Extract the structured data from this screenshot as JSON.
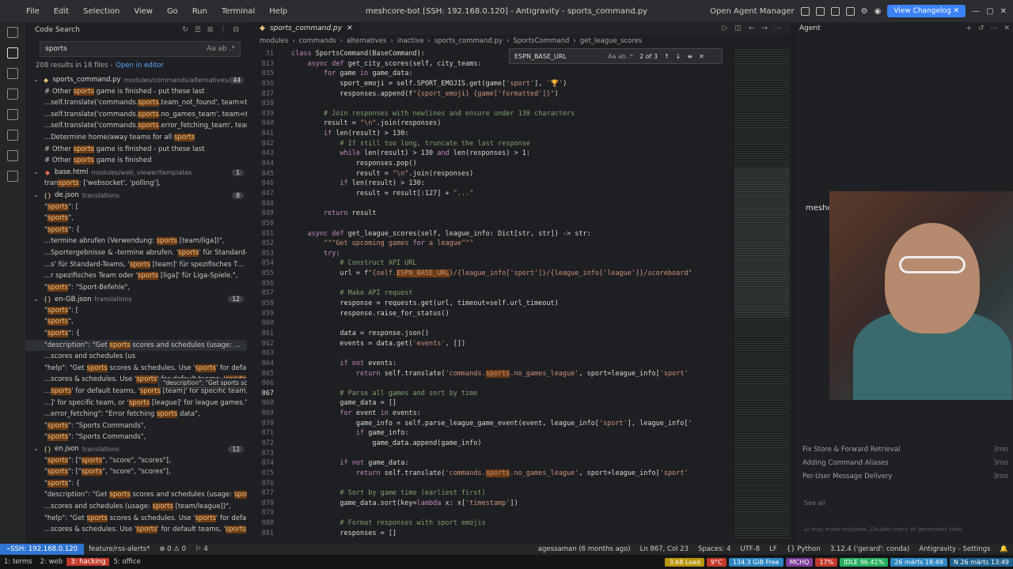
{
  "titlebar": {
    "menu": [
      "File",
      "Edit",
      "Selection",
      "View",
      "Go",
      "Run",
      "Terminal",
      "Help"
    ],
    "title": "meshcore-bot [SSH: 192.168.0.120] - Antigravity - sports_command.py",
    "open_agent_manager": "Open Agent Manager",
    "changelog_label": "View Changelog"
  },
  "sidebar": {
    "title": "Code Search",
    "query": "sports",
    "summary": "208 results in 18 files -",
    "open_in_editor": "Open in editor",
    "tooltip": "\"description\": \"Get sports scores and schedules (usage: sports [team/league])\","
  },
  "results": [
    {
      "type": "file",
      "name": "sports_command.py",
      "path": "modules/commands/alternatives/in...",
      "count": "44",
      "icon": "python-icon"
    },
    {
      "type": "line",
      "text": "# Other sports game is finished - put these last"
    },
    {
      "type": "line",
      "text": "...self.translate('commands.sports.team_not_found', team=tea..."
    },
    {
      "type": "line",
      "text": "...self.translate('commands.sports.no_games_team', team=tea..."
    },
    {
      "type": "line",
      "text": "...self.translate('commands.sports.error_fetching_team', team..."
    },
    {
      "type": "line",
      "text": "...Determine home/away teams for all sports"
    },
    {
      "type": "line",
      "text": "# Other sports game is finished - put these last"
    },
    {
      "type": "line",
      "text": "# Other sports game is finished"
    },
    {
      "type": "file",
      "name": "base.html",
      "path": "modules/web_viewer/templates",
      "count": "1",
      "icon": "html-icon"
    },
    {
      "type": "line",
      "text": "transports: ['websocket', 'polling'],"
    },
    {
      "type": "file",
      "name": "de.json",
      "path": "translations",
      "count": "8",
      "icon": "json-icon"
    },
    {
      "type": "line",
      "text": "\"sports\": ["
    },
    {
      "type": "line",
      "text": "\"sports\","
    },
    {
      "type": "line",
      "text": "\"sports\": {"
    },
    {
      "type": "line",
      "text": "...termine abrufen (Verwendung: sports [team/liga])\","
    },
    {
      "type": "line",
      "text": "...Sportergebnisse & -termine abrufen. 'sports' für Standard-Te..."
    },
    {
      "type": "line",
      "text": "...s' für Standard-Teams, 'sports [team]' für spezifisches T..."
    },
    {
      "type": "line",
      "text": "...r spezifisches Team oder 'sports [liga]' für Liga-Spiele.\","
    },
    {
      "type": "line",
      "text": "\"sports\": \"Sport-Befehle\","
    },
    {
      "type": "file",
      "name": "en-GB.json",
      "path": "translations",
      "count": "12",
      "icon": "json-icon"
    },
    {
      "type": "line",
      "text": "\"sports\": ["
    },
    {
      "type": "line",
      "text": "\"sports\","
    },
    {
      "type": "line",
      "text": "\"sports\": {"
    },
    {
      "type": "line",
      "text": "\"description\": \"Get sports scores and schedules (usage: ...",
      "selected": true
    },
    {
      "type": "line",
      "text": "...scores and schedules (us"
    },
    {
      "type": "line",
      "text": "\"help\": \"Get sports scores & schedules. Use 'sports' for default..."
    },
    {
      "type": "line",
      "text": "...scores & schedules. Use 'sports' for default teams, 'sports [te..."
    },
    {
      "type": "line",
      "text": "...sports' for default teams, 'sports [team]' for specific team, or..."
    },
    {
      "type": "line",
      "text": "...]' for specific team, or 'sports [league]' for league games.\","
    },
    {
      "type": "line",
      "text": "...error_fetching\": \"Error fetching sports data\","
    },
    {
      "type": "line",
      "text": "\"sports\": \"Sports Commands\","
    },
    {
      "type": "line",
      "text": "\"sports\": \"Sports Commands\","
    },
    {
      "type": "file",
      "name": "en.json",
      "path": "translations",
      "count": "12",
      "icon": "json-icon"
    },
    {
      "type": "line",
      "text": "\"sports\": [\"sports\", \"score\", \"scores\"],"
    },
    {
      "type": "line",
      "text": "\"sports\": [\"sports\", \"score\", \"scores\"],"
    },
    {
      "type": "line",
      "text": "\"sports\": {"
    },
    {
      "type": "line",
      "text": "\"description\": \"Get sports scores and schedules (usage: sports ..."
    },
    {
      "type": "line",
      "text": "...scores and schedules (usage: sports [team/league])\","
    },
    {
      "type": "line",
      "text": "\"help\": \"Get sports scores & schedules. Use 'sports' for default..."
    },
    {
      "type": "line",
      "text": "...scores & schedules. Use 'sports' for default teams, 'sports [te..."
    }
  ],
  "editor": {
    "tab": "sports_command.py",
    "breadcrumb": [
      "modules",
      "commands",
      "alternatives",
      "inactive",
      "sports_command.py",
      "SportsCommand",
      "get_league_scores"
    ],
    "find": {
      "query": "ESPN_BASE_URL",
      "count": "2 of 3"
    },
    "current_line": "867",
    "lines": [
      {
        "no": "31",
        "text": "class SportsCommand(BaseCommand):"
      },
      {
        "no": "813",
        "text": "    async def get_city_scores(self, city_teams:"
      },
      {
        "no": "835",
        "text": "        for game in game_data:"
      },
      {
        "no": "836",
        "text": "            sport_emoji = self.SPORT_EMOJIS.get(game['sport'], '🏆')"
      },
      {
        "no": "837",
        "text": "            responses.append(f\"{sport_emoji} {game['formatted']}\")"
      },
      {
        "no": "838",
        "text": ""
      },
      {
        "no": "839",
        "text": "        # Join responses with newlines and ensure under 130 characters"
      },
      {
        "no": "840",
        "text": "        result = \"\\n\".join(responses)"
      },
      {
        "no": "841",
        "text": "        if len(result) > 130:"
      },
      {
        "no": "842",
        "text": "            # If still too long, truncate the last response"
      },
      {
        "no": "843",
        "text": "            while len(result) > 130 and len(responses) > 1:"
      },
      {
        "no": "844",
        "text": "                responses.pop()"
      },
      {
        "no": "845",
        "text": "                result = \"\\n\".join(responses)"
      },
      {
        "no": "846",
        "text": "            if len(result) > 130:"
      },
      {
        "no": "847",
        "text": "                result = result[:127] + \"...\""
      },
      {
        "no": "848",
        "text": ""
      },
      {
        "no": "849",
        "text": "        return result"
      },
      {
        "no": "850",
        "text": ""
      },
      {
        "no": "851",
        "text": "    async def get_league_scores(self, league_info: Dict[str, str]) -> str:"
      },
      {
        "no": "852",
        "text": "        \"\"\"Get upcoming games for a league\"\"\""
      },
      {
        "no": "853",
        "text": "        try:"
      },
      {
        "no": "854",
        "text": "            # Construct API URL"
      },
      {
        "no": "855",
        "text": "            url = f\"{self.ESPN_BASE_URL}/{league_info['sport']}/{league_info['league']}/scoreboard\""
      },
      {
        "no": "856",
        "text": ""
      },
      {
        "no": "857",
        "text": "            # Make API request"
      },
      {
        "no": "858",
        "text": "            response = requests.get(url, timeout=self.url_timeout)"
      },
      {
        "no": "859",
        "text": "            response.raise_for_status()"
      },
      {
        "no": "860",
        "text": ""
      },
      {
        "no": "861",
        "text": "            data = response.json()"
      },
      {
        "no": "862",
        "text": "            events = data.get('events', [])"
      },
      {
        "no": "863",
        "text": ""
      },
      {
        "no": "864",
        "text": "            if not events:"
      },
      {
        "no": "865",
        "text": "                return self.translate('commands.sports.no_games_league', sport=league_info['sport'"
      },
      {
        "no": "866",
        "text": ""
      },
      {
        "no": "867",
        "text": "            # Parse all games and sort by time"
      },
      {
        "no": "868",
        "text": "            game_data = []"
      },
      {
        "no": "869",
        "text": "            for event in events:"
      },
      {
        "no": "870",
        "text": "                game_info = self.parse_league_game_event(event, league_info['sport'], league_info['"
      },
      {
        "no": "871",
        "text": "                if game_info:"
      },
      {
        "no": "872",
        "text": "                    game_data.append(game_info)"
      },
      {
        "no": "873",
        "text": ""
      },
      {
        "no": "874",
        "text": "            if not game_data:"
      },
      {
        "no": "875",
        "text": "                return self.translate('commands.sports.no_games_league', sport=league_info['sport'"
      },
      {
        "no": "876",
        "text": ""
      },
      {
        "no": "877",
        "text": "            # Sort by game time (earliest first)"
      },
      {
        "no": "878",
        "text": "            game_data.sort(key=lambda x: x['timestamp'])"
      },
      {
        "no": "879",
        "text": ""
      },
      {
        "no": "880",
        "text": "            # Format responses with sport emojis"
      },
      {
        "no": "881",
        "text": "            responses = []"
      }
    ]
  },
  "agent": {
    "title": "Agent",
    "header_text": "meshc",
    "conversations": [
      {
        "title": "Fix Store & Forward Retrieval",
        "time": "3mo"
      },
      {
        "title": "Adding Command Aliases",
        "time": "3mo"
      },
      {
        "title": "Per-User Message Delivery",
        "time": "3mo"
      }
    ],
    "see_all": "See all",
    "disclaimer": "AI may make mistakes. Double-check all generated code."
  },
  "statusbar": {
    "remote": "SSH: 192.168.0.120",
    "branch": "feature/rss-alerts*",
    "errors": "⊗ 0 ⚠ 0",
    "ports": "⚐ 4",
    "blame": "agessaman (6 months ago)",
    "cursor": "Ln 867, Col 23",
    "spaces": "Spaces: 4",
    "encoding": "UTF-8",
    "eol": "LF",
    "language": "{} Python",
    "interpreter": "3.12.4 ('gerard': conda)",
    "settings": "Antigravity - Settings"
  },
  "tmux": {
    "windows": [
      "1: terms",
      "2: web",
      "3: hacking",
      "5: office"
    ],
    "active": "3: hacking",
    "right": [
      "3.68 Load",
      "9°C",
      "134.3 GiB Free",
      "MCHQ",
      "17%",
      "IDLE 96.41%",
      "26 märts 18:49",
      "N 26 märts 13:49"
    ]
  },
  "colors": {
    "accent": "#2f74d0",
    "highlight": "#6b3b14",
    "tmux_active": "#c0392b"
  }
}
